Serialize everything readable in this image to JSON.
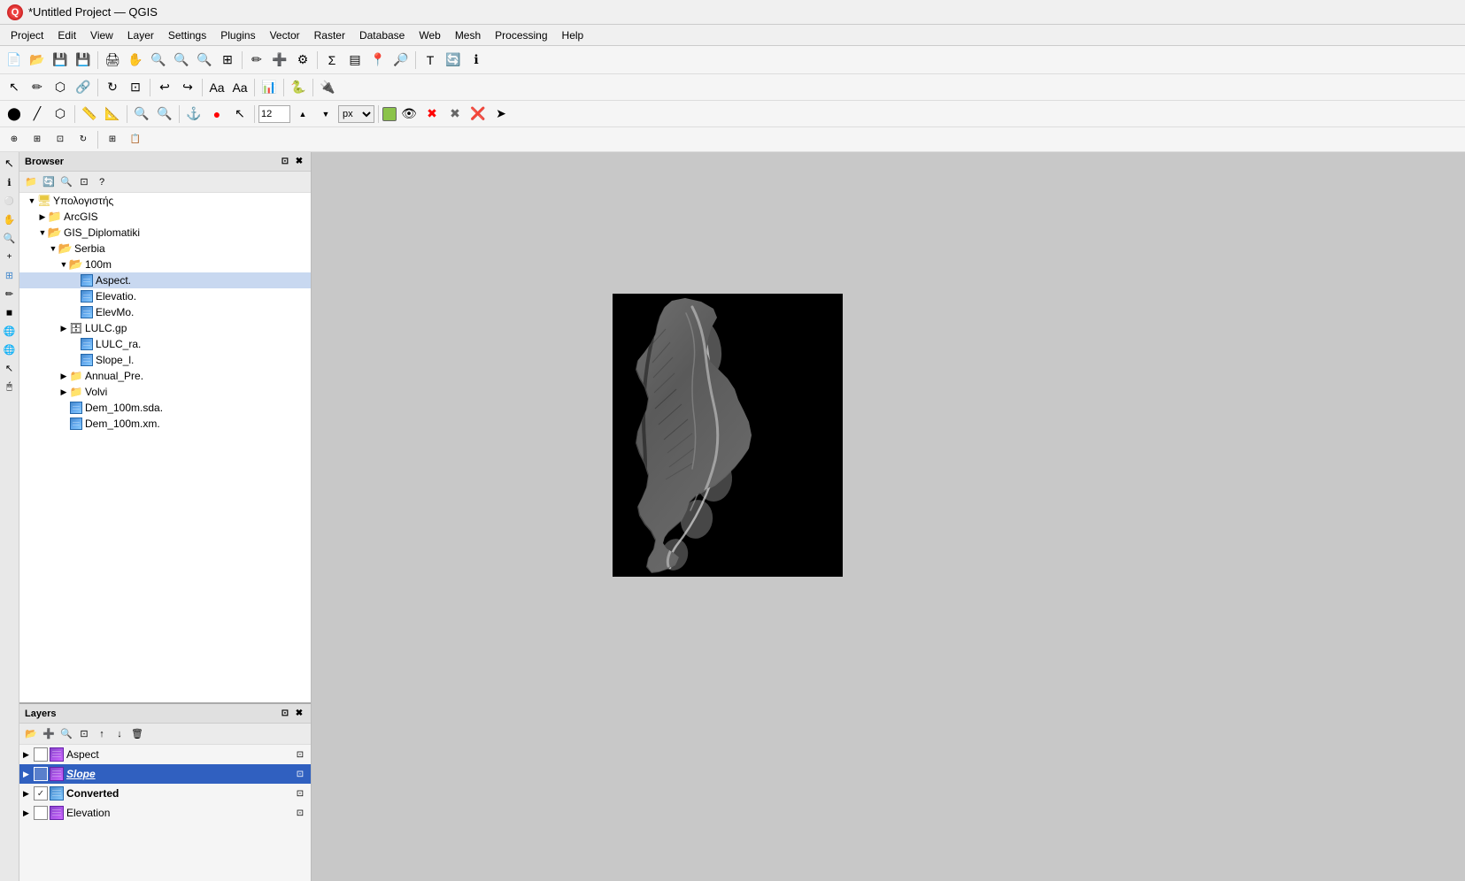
{
  "titlebar": {
    "title": "*Untitled Project — QGIS",
    "logo": "Q"
  },
  "menubar": {
    "items": [
      "Project",
      "Edit",
      "View",
      "Layer",
      "Settings",
      "Plugins",
      "Vector",
      "Raster",
      "Database",
      "Web",
      "Mesh",
      "Processing",
      "Help"
    ]
  },
  "browser_panel": {
    "title": "Browser",
    "toolbar_icons": [
      "add-dir",
      "refresh",
      "filter",
      "collapse",
      "help"
    ],
    "tree": [
      {
        "id": "computer",
        "label": "Υπολογιστής",
        "level": 0,
        "type": "computer",
        "expanded": true
      },
      {
        "id": "arcgis",
        "label": "ArcGIS",
        "level": 1,
        "type": "folder",
        "expanded": false
      },
      {
        "id": "gis_dip",
        "label": "GIS_Diplomatiki",
        "level": 1,
        "type": "folder",
        "expanded": true
      },
      {
        "id": "serbia",
        "label": "Serbia",
        "level": 2,
        "type": "folder",
        "expanded": true
      },
      {
        "id": "100m",
        "label": "100m",
        "level": 3,
        "type": "folder",
        "expanded": true
      },
      {
        "id": "aspect",
        "label": "Aspect.",
        "level": 4,
        "type": "raster",
        "expanded": false
      },
      {
        "id": "elevation",
        "label": "Elevatio.",
        "level": 4,
        "type": "raster",
        "expanded": false
      },
      {
        "id": "elevmo",
        "label": "ElevMo.",
        "level": 4,
        "type": "raster",
        "expanded": false
      },
      {
        "id": "lulc_gp",
        "label": "LULC.gp",
        "level": 4,
        "type": "vector",
        "expanded": false,
        "hasarrow": true
      },
      {
        "id": "lulc_ra",
        "label": "LULC_ra.",
        "level": 4,
        "type": "raster",
        "expanded": false
      },
      {
        "id": "slope_l",
        "label": "Slope_l.",
        "level": 4,
        "type": "raster",
        "expanded": false
      },
      {
        "id": "annual_pre",
        "label": "Annual_Pre.",
        "level": 3,
        "type": "folder",
        "expanded": false,
        "hasarrow": true
      },
      {
        "id": "volvi",
        "label": "Volvi",
        "level": 3,
        "type": "folder",
        "expanded": false,
        "hasarrow": true
      },
      {
        "id": "dem_sda",
        "label": "Dem_100m.sda.",
        "level": 3,
        "type": "raster",
        "expanded": false
      },
      {
        "id": "dem_xm",
        "label": "Dem_100m.xm.",
        "level": 3,
        "type": "raster",
        "expanded": false
      }
    ]
  },
  "layers_panel": {
    "title": "Layers",
    "toolbar_icons": [
      "open",
      "add",
      "filter",
      "sort",
      "move-up",
      "move-down",
      "remove"
    ],
    "layers": [
      {
        "id": "aspect",
        "name": "Aspect",
        "checked": false,
        "visible": true,
        "selected": false,
        "bold": false
      },
      {
        "id": "slope",
        "name": "Slope",
        "checked": false,
        "visible": true,
        "selected": true,
        "bold": true,
        "italic": true
      },
      {
        "id": "converted",
        "name": "Converted",
        "checked": true,
        "visible": true,
        "selected": false,
        "bold": true
      },
      {
        "id": "elevation",
        "name": "Elevation",
        "checked": false,
        "visible": true,
        "selected": false,
        "bold": false
      }
    ]
  },
  "map": {
    "background": "#c8c8c8",
    "raster_bg": "#000000"
  },
  "colors": {
    "selected_layer_bg": "#3060c0",
    "selected_layer_text": "#ffffff",
    "toolbar_bg": "#f5f5f5",
    "panel_header_bg": "#e0e0e0"
  }
}
